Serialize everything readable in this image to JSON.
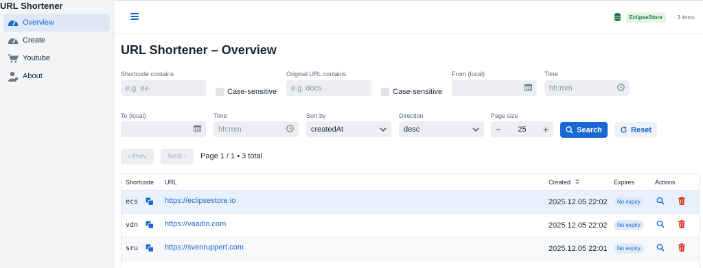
{
  "app": {
    "title": "URL Shortener"
  },
  "sidebar": {
    "items": [
      {
        "label": "Overview",
        "icon": "gauge-icon",
        "active": true
      },
      {
        "label": "Create",
        "icon": "gauge-icon"
      },
      {
        "label": "Youtube",
        "icon": "cart-icon"
      },
      {
        "label": "About",
        "icon": "user-icon"
      }
    ]
  },
  "header": {
    "store_badge": "EclipseStore",
    "items_count": "· 3 items"
  },
  "page": {
    "title": "URL Shortener – Overview"
  },
  "filters": {
    "shortcode_label": "Shortcode contains",
    "shortcode_placeholder": "e.g. ex-",
    "case_sensitive_label": "Case-sensitive",
    "original_url_label": "Original URL contains",
    "original_url_placeholder": "e.g. docs",
    "from_label": "From (local)",
    "time_label": "Time",
    "time_placeholder": "hh:mm",
    "to_label": "To (local)",
    "sort_by_label": "Sort by",
    "sort_by_value": "createdAt",
    "direction_label": "Direction",
    "direction_value": "desc",
    "page_size_label": "Page size",
    "page_size_value": "25",
    "search_label": "Search",
    "reset_label": "Reset"
  },
  "pagination": {
    "prev_label": "‹ Prev",
    "next_label": "Next ›",
    "info": "Page 1 / 1 • 3 total"
  },
  "table": {
    "headers": {
      "shortcode": "Shortcode",
      "url": "URL",
      "created": "Created",
      "expires": "Expires",
      "actions": "Actions"
    },
    "rows": [
      {
        "code": "ecs",
        "url": "https://eclipsestore.io",
        "created": "2025.12.05 22:02",
        "expires": "No expiry"
      },
      {
        "code": "vdn",
        "url": "https://vaadin.com",
        "created": "2025.12.05 22:02",
        "expires": "No expiry"
      },
      {
        "code": "sru",
        "url": "https://svenruppert.com",
        "created": "2025.12.05 22:01",
        "expires": "No expiry"
      }
    ]
  },
  "colors": {
    "accent": "#1967d2",
    "danger": "#d93025",
    "success": "#1e7b3f"
  }
}
